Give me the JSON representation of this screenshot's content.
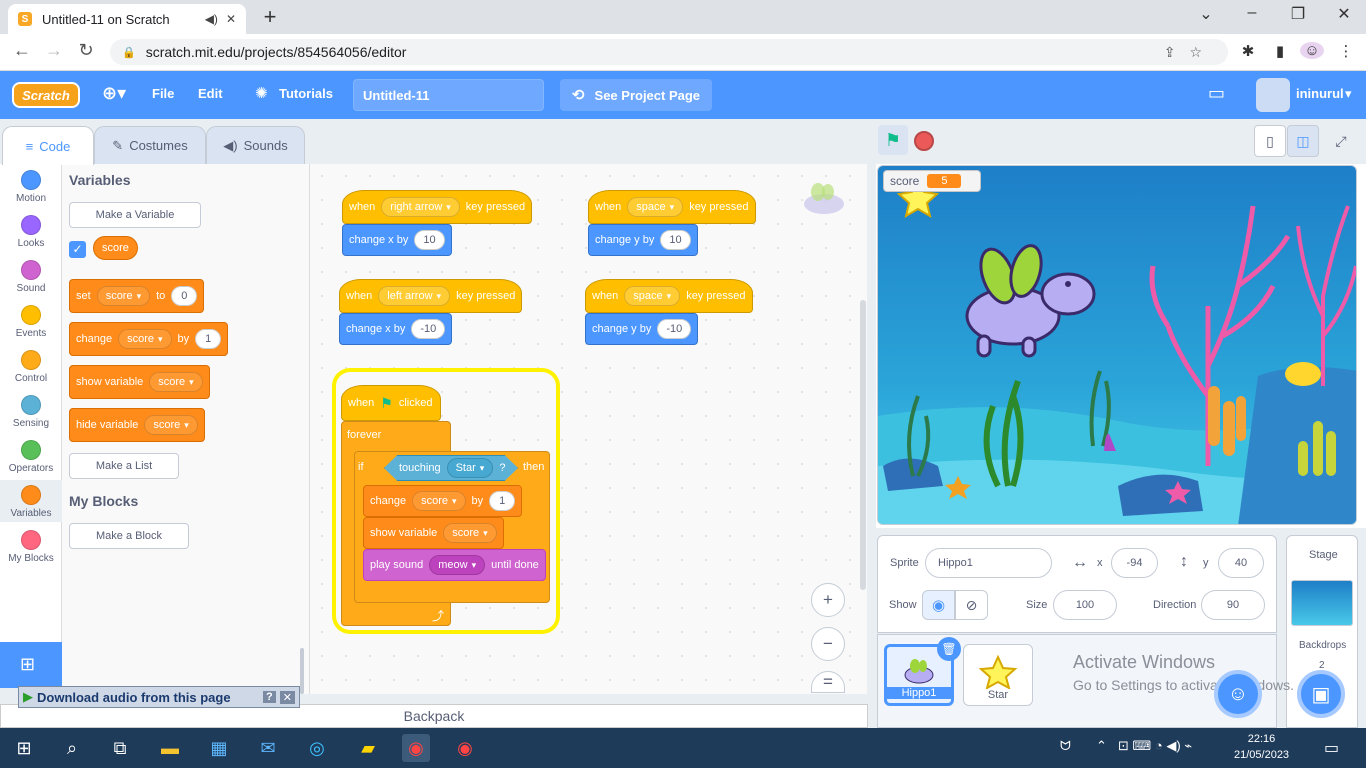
{
  "browser": {
    "tab_title": "Untitled-11 on Scratch",
    "tab_favicon": "S",
    "url": "scratch.mit.edu/projects/854564056/editor"
  },
  "menu": {
    "logo": "Scratch",
    "file": "File",
    "edit": "Edit",
    "tutorials": "Tutorials",
    "project_title": "Untitled-11",
    "see_project": "See Project Page",
    "username": "ininurul"
  },
  "tabs": {
    "code": "Code",
    "costumes": "Costumes",
    "sounds": "Sounds"
  },
  "categories": [
    {
      "label": "Motion",
      "color": "#4c97ff"
    },
    {
      "label": "Looks",
      "color": "#9966ff"
    },
    {
      "label": "Sound",
      "color": "#cf63cf"
    },
    {
      "label": "Events",
      "color": "#ffbf00"
    },
    {
      "label": "Control",
      "color": "#ffab19"
    },
    {
      "label": "Sensing",
      "color": "#5cb1d6"
    },
    {
      "label": "Operators",
      "color": "#59c059"
    },
    {
      "label": "Variables",
      "color": "#ff8c1a"
    },
    {
      "label": "My Blocks",
      "color": "#ff6680"
    }
  ],
  "palette": {
    "variables_heading": "Variables",
    "make_variable": "Make a Variable",
    "var_name": "score",
    "set_block": {
      "text": "set",
      "var": "score",
      "to": "to",
      "value": "0"
    },
    "change_block": {
      "text": "change",
      "var": "score",
      "by": "by",
      "value": "1"
    },
    "show_block": {
      "text": "show variable",
      "var": "score"
    },
    "hide_block": {
      "text": "hide variable",
      "var": "score"
    },
    "make_list": "Make a List",
    "myblocks_heading": "My Blocks",
    "make_block": "Make a Block"
  },
  "scripts": {
    "s1": {
      "when": "when",
      "key": "right arrow",
      "pressed": "key pressed",
      "action": "change x by",
      "value": "10"
    },
    "s2": {
      "when": "when",
      "key": "left arrow",
      "pressed": "key pressed",
      "action": "change x by",
      "value": "-10"
    },
    "s3": {
      "when": "when",
      "key": "space",
      "pressed": "key pressed",
      "action": "change y by",
      "value": "10"
    },
    "s4": {
      "when": "when",
      "key": "space",
      "pressed": "key pressed",
      "action": "change y by",
      "value": "-10"
    },
    "main": {
      "when": "when",
      "clicked": "clicked",
      "forever": "forever",
      "if": "if",
      "touching": "touching",
      "sprite": "Star",
      "q": "?",
      "then": "then",
      "change": "change",
      "var": "score",
      "by": "by",
      "value": "1",
      "show": "show variable",
      "show_var": "score",
      "play": "play sound",
      "sound": "meow",
      "until": "until done"
    }
  },
  "zoom": {
    "in": "+",
    "out": "−",
    "reset": "="
  },
  "backpack": "Backpack",
  "download_bar": "Download audio from this page",
  "stage_monitor": {
    "label": "score",
    "value": "5"
  },
  "sprite_info": {
    "sprite_label": "Sprite",
    "sprite_name": "Hippo1",
    "x_label": "x",
    "x": "-94",
    "y_label": "y",
    "y": "40",
    "show_label": "Show",
    "size_label": "Size",
    "size": "100",
    "direction_label": "Direction",
    "direction": "90"
  },
  "sprites": [
    {
      "name": "Hippo1"
    },
    {
      "name": "Star"
    }
  ],
  "stage_panel": {
    "title": "Stage",
    "backdrops_label": "Backdrops",
    "backdrops_count": "2"
  },
  "watermark": {
    "line1": "Activate Windows",
    "line2": "Go to Settings to activate Windows."
  },
  "taskbar": {
    "time": "22:16",
    "date": "21/05/2023"
  }
}
